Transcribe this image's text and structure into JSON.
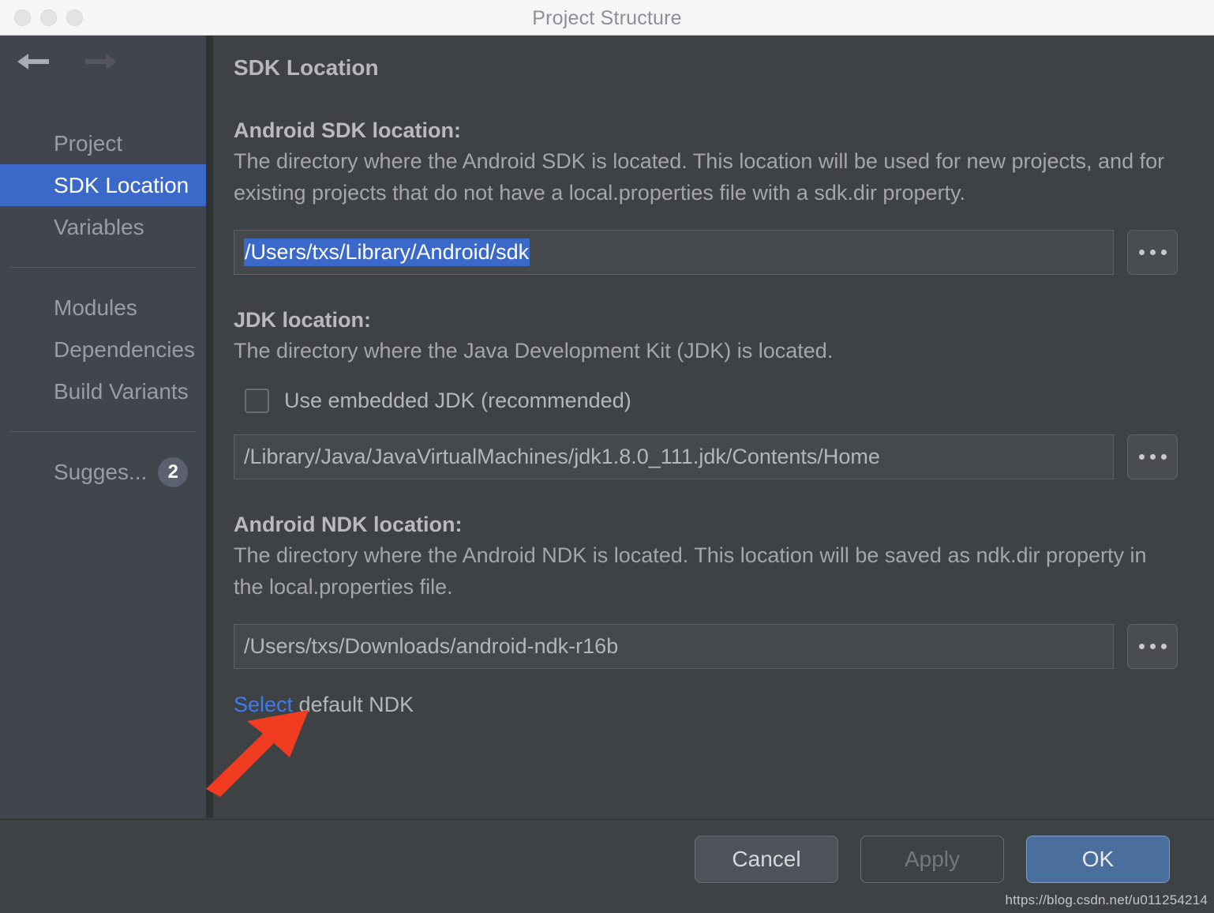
{
  "window": {
    "title": "Project Structure",
    "traffic_lights": [
      "close-button",
      "minimize-button",
      "zoom-button"
    ]
  },
  "sidebar": {
    "back_icon": "arrow-left-icon",
    "forward_icon": "arrow-right-icon",
    "items": [
      {
        "label": "Project",
        "selected": false
      },
      {
        "label": "SDK Location",
        "selected": true
      },
      {
        "label": "Variables",
        "selected": false
      },
      {
        "label": "Modules",
        "selected": false
      },
      {
        "label": "Dependencies",
        "selected": false
      },
      {
        "label": "Build Variants",
        "selected": false
      },
      {
        "label": "Sugges...",
        "selected": false,
        "badge": "2"
      }
    ]
  },
  "main": {
    "page_title": "SDK Location",
    "sdk": {
      "heading": "Android SDK location:",
      "description": "The directory where the Android SDK is located. This location will be used for new projects, and for existing projects that do not have a local.properties file with a sdk.dir property.",
      "value": "/Users/txs/Library/Android/sdk",
      "value_selected": true,
      "browse_label": "...",
      "browse_icon": "ellipsis-icon"
    },
    "jdk": {
      "heading": "JDK location:",
      "description": "The directory where the Java Development Kit (JDK) is located.",
      "checkbox_label": "Use embedded JDK (recommended)",
      "checkbox_checked": false,
      "value": "/Library/Java/JavaVirtualMachines/jdk1.8.0_111.jdk/Contents/Home",
      "browse_label": "...",
      "browse_icon": "ellipsis-icon"
    },
    "ndk": {
      "heading": "Android NDK location:",
      "description": "The directory where the Android NDK is located. This location will be saved as ndk.dir property in the local.properties file.",
      "value": "/Users/txs/Downloads/android-ndk-r16b",
      "browse_label": "...",
      "browse_icon": "ellipsis-icon",
      "link_text": "Select",
      "link_suffix": " default NDK"
    }
  },
  "footer": {
    "cancel_label": "Cancel",
    "apply_label": "Apply",
    "apply_enabled": false,
    "ok_label": "OK"
  },
  "annotation": {
    "arrow_icon": "red-arrow-icon",
    "arrow_color": "#f23c22"
  },
  "watermark": {
    "text": "https://blog.csdn.net/u011254214"
  }
}
